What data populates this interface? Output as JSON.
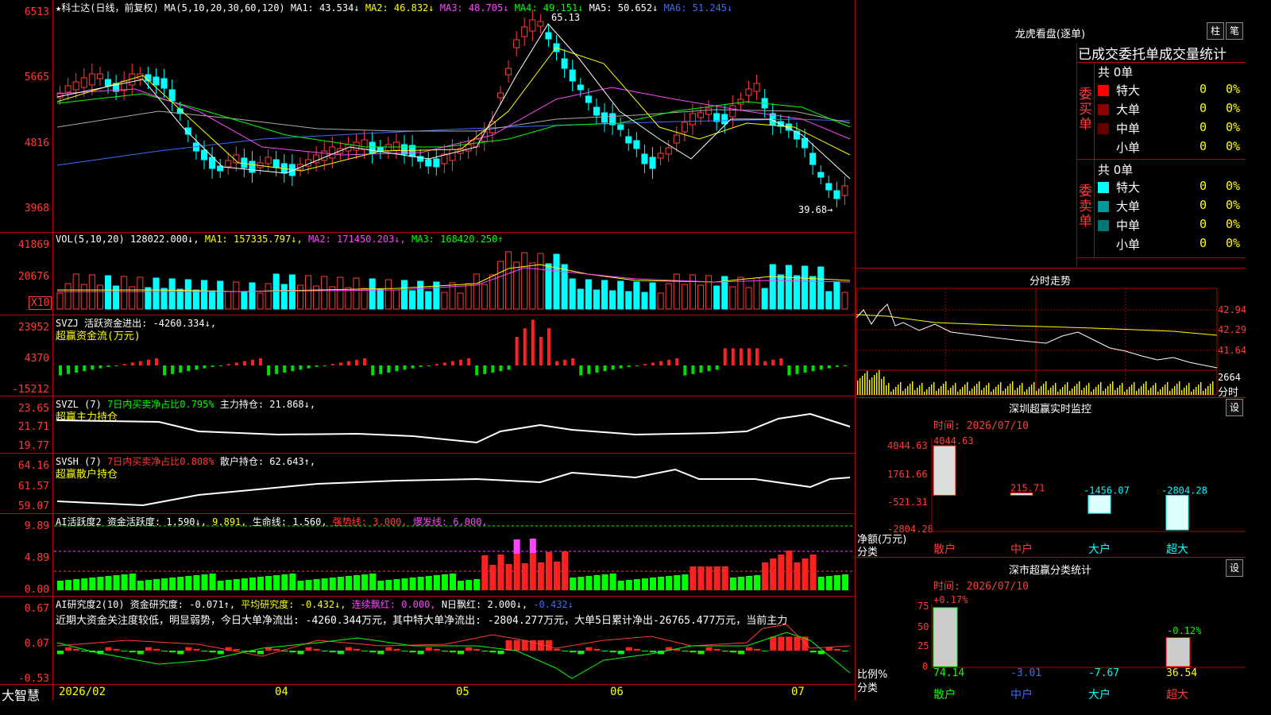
{
  "main": {
    "title": "★科士达(日线，前复权)",
    "ma_header": "MA(5,10,20,30,60,120)",
    "ma1": "MA1: 43.534↓",
    "ma2": "MA2: 46.832↓",
    "ma3": "MA3: 48.705↓",
    "ma4": "MA4: 49.151↓",
    "ma5": "MA5: 50.652↓",
    "ma6": "MA6: 51.245↓",
    "y_ticks": [
      "6513",
      "5665",
      "4816",
      "3968"
    ],
    "high_label": "65.13",
    "low_label": "39.68→",
    "colors": {
      "up": "#ff3b3b",
      "down": "#00ffff",
      "ma1": "#ffffff",
      "ma2": "#ffff00",
      "ma3": "#ff44ff",
      "ma4": "#00ff00",
      "ma5": "#aaaaaa",
      "ma6": "#3f6bff"
    }
  },
  "vol": {
    "header": "VOL(5,10,20)",
    "value": "128022.000↓,",
    "ma1": "MA1: 157335.797↓,",
    "ma2": "MA2: 171450.203↓,",
    "ma3": "MA3: 168420.250↑",
    "y_ticks": [
      "41869",
      "20676"
    ],
    "unit": "X10"
  },
  "svzj": {
    "header": "SVZJ  活跃资金进出: -4260.334↓,",
    "subtitle": "超赢资金流(万元)",
    "y_ticks": [
      "23952",
      "4370",
      "-15212"
    ]
  },
  "svzl": {
    "header": "SVZL (7)",
    "ratio": "7日内买卖净占比0.795%",
    "hold": "主力持仓: 21.868↓,",
    "subtitle": "超赢主力持仓",
    "y_ticks": [
      "23.65",
      "21.71",
      "19.77"
    ]
  },
  "svsh": {
    "header": "SVSH (7)",
    "ratio": "7日内买卖净占比0.808%",
    "hold": "散户持仓: 62.643↑,",
    "subtitle": "超赢散户持仓",
    "y_ticks": [
      "64.16",
      "61.57",
      "59.07"
    ]
  },
  "ai1": {
    "header": "AI活跃度2 资金活跃度: 1.590↓,",
    "v2": "9.891,",
    "life": "生命线: 1.560,",
    "strong": "强势线: 3.000,",
    "burst": "爆发线: 6.000,",
    "y_ticks": [
      "9.89",
      "4.89",
      "0.00"
    ]
  },
  "ai2": {
    "header": "AI研究度2(10) 资金研究度: -0.071↑,",
    "avg": "平均研究度: -0.432↓,",
    "red": "连续飘红: 0.000,",
    "n": "N日飘红: 2.000↓,",
    "last": "-0.432↓",
    "comment": "近期大资金关注度较低，明显弱势，今日大单净流出: -4260.344万元，其中特大单净流出: -2804.277万元，大单5日累计净出-26765.477万元，当前主力",
    "y_ticks": [
      "0.67",
      "0.07",
      "-0.53"
    ]
  },
  "xaxis": {
    "brand": "大智慧",
    "labels": [
      "2026/02",
      "04",
      "05",
      "06",
      "07"
    ]
  },
  "dragon": {
    "title": "龙虎看盘(逐单)",
    "btn1": "柱",
    "btn2": "笔",
    "header": "已成交委托单成交量统计",
    "buy_label": "委买单",
    "sell_label": "委卖单",
    "buy_total": "共 0单",
    "sell_total": "共 0单",
    "buy_rows": [
      {
        "name": "特大",
        "val": "0",
        "pct": "0%",
        "color": "#ff0000"
      },
      {
        "name": "大单",
        "val": "0",
        "pct": "0%",
        "color": "#8b0000"
      },
      {
        "name": "中单",
        "val": "0",
        "pct": "0%",
        "color": "#660000"
      },
      {
        "name": "小单",
        "val": "0",
        "pct": "0%",
        "color": "#000000"
      }
    ],
    "sell_rows": [
      {
        "name": "特大",
        "val": "0",
        "pct": "0%",
        "color": "#00ffff"
      },
      {
        "name": "大单",
        "val": "0",
        "pct": "0%",
        "color": "#009999"
      },
      {
        "name": "中单",
        "val": "0",
        "pct": "0%",
        "color": "#007777"
      },
      {
        "name": "小单",
        "val": "0",
        "pct": "0%",
        "color": "#000000"
      }
    ]
  },
  "intraday": {
    "title": "分时走势",
    "y_ticks": [
      "42.94",
      "42.29",
      "41.64"
    ],
    "vol_label": "2664",
    "time_label": "分时"
  },
  "sz_monitor": {
    "title": "深圳超赢实时监控",
    "btn": "设",
    "date": "时间: 2026/07/10",
    "y_ticks": [
      "4044.63",
      "1761.66",
      "-521.31",
      "-2804.28"
    ],
    "ylabel": "净额(万元)",
    "xlabel": "分类",
    "categories": [
      "散户",
      "中户",
      "大户",
      "超大"
    ],
    "labels": [
      "4044.63",
      "215.71",
      "-1456.07",
      "-2804.28"
    ]
  },
  "sz_class": {
    "title": "深市超赢分类统计",
    "btn": "设",
    "date": "时间: 2026/07/10",
    "y_ticks": [
      "75",
      "50",
      "25",
      "0"
    ],
    "ylabel": "比例%",
    "xlabel": "分类",
    "categories": [
      "散户",
      "中户",
      "大户",
      "超大"
    ],
    "values": [
      "74.14",
      "-3.01",
      "-7.67",
      "36.54"
    ],
    "top1": "+0.17%",
    "top4": "-0.12%"
  },
  "chart_data": [
    {
      "type": "bar",
      "title": "深圳超赢实时监控",
      "categories": [
        "散户",
        "中户",
        "大户",
        "超大"
      ],
      "values": [
        4044.63,
        215.71,
        -1456.07,
        -2804.28
      ],
      "ylabel": "净额(万元)",
      "ylim": [
        -2804.28,
        4044.63
      ]
    },
    {
      "type": "bar",
      "title": "深市超赢分类统计",
      "categories": [
        "散户",
        "中户",
        "大户",
        "超大"
      ],
      "values": [
        74.14,
        0,
        0,
        36.54
      ],
      "ylabel": "比例%",
      "ylim": [
        0,
        75
      ]
    }
  ]
}
